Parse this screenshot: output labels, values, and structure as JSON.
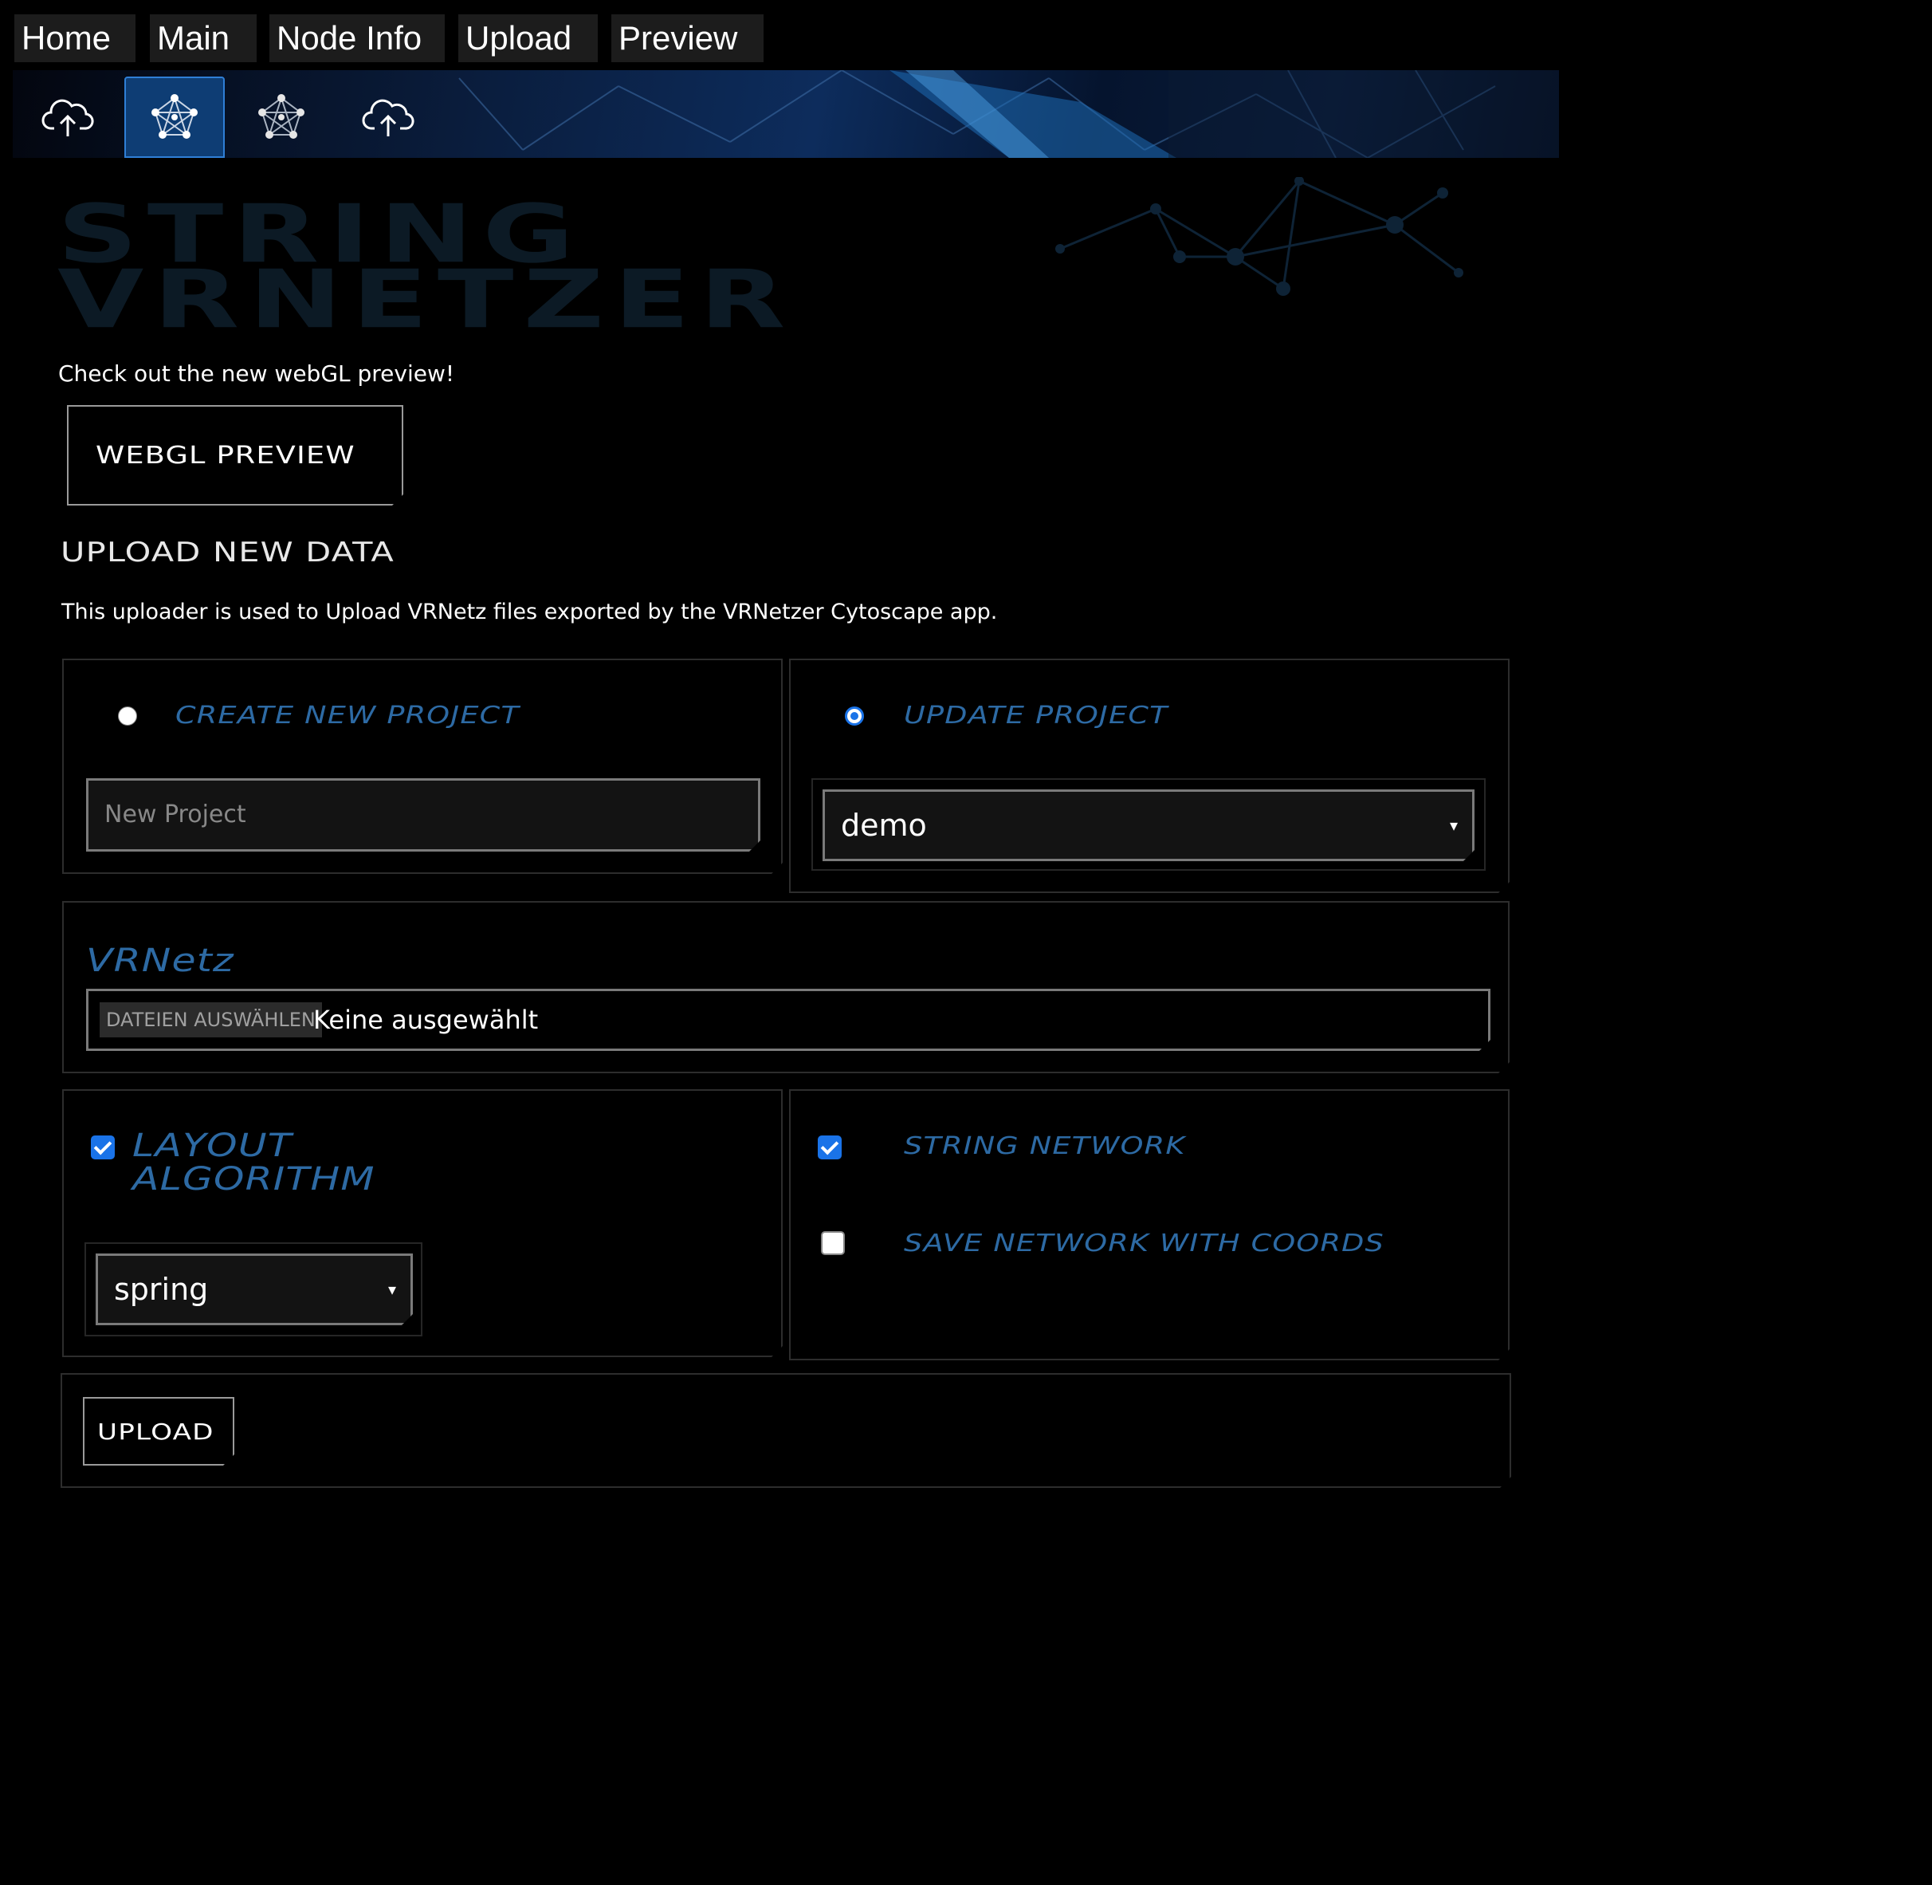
{
  "nav": {
    "tabs": [
      {
        "label": "Home"
      },
      {
        "label": "Main"
      },
      {
        "label": "Node Info"
      },
      {
        "label": "Upload"
      },
      {
        "label": "Preview"
      }
    ]
  },
  "toolbar": {
    "icons": [
      "cloud-upload-icon",
      "network-icon",
      "network-icon",
      "cloud-upload-icon"
    ],
    "active_index": 1
  },
  "header": {
    "title_line1": "STRING",
    "title_line2": "VRNETZER"
  },
  "preview": {
    "note": "Check out the new webGL preview!",
    "button_label": "WEBGL PREVIEW"
  },
  "upload": {
    "heading": "UPLOAD NEW DATA",
    "description": "This uploader is used to Upload VRNetz files exported by the VRNetzer Cytoscape app.",
    "create_project": {
      "label": "CREATE NEW PROJECT",
      "selected": false,
      "placeholder": "New Project"
    },
    "update_project": {
      "label": "UPDATE PROJECT",
      "selected": true,
      "value": "demo"
    },
    "vrnetz": {
      "label": "VRNetz",
      "button_label": "DATEIEN AUSWÄHLEN",
      "status": "Keine ausgewählt"
    },
    "layout": {
      "label_line1": "LAYOUT",
      "label_line2": "ALGORITHM",
      "checked": true,
      "value": "spring"
    },
    "string_network": {
      "label": "STRING NETWORK",
      "checked": true
    },
    "save_coords": {
      "label": "SAVE NETWORK WITH COORDS",
      "checked": false
    },
    "submit_label": "UPLOAD"
  },
  "colors": {
    "background": "#000000",
    "accent_blue": "#2d6aa4",
    "checkbox_blue": "#1a73e8",
    "border": "#2d2d2d"
  }
}
